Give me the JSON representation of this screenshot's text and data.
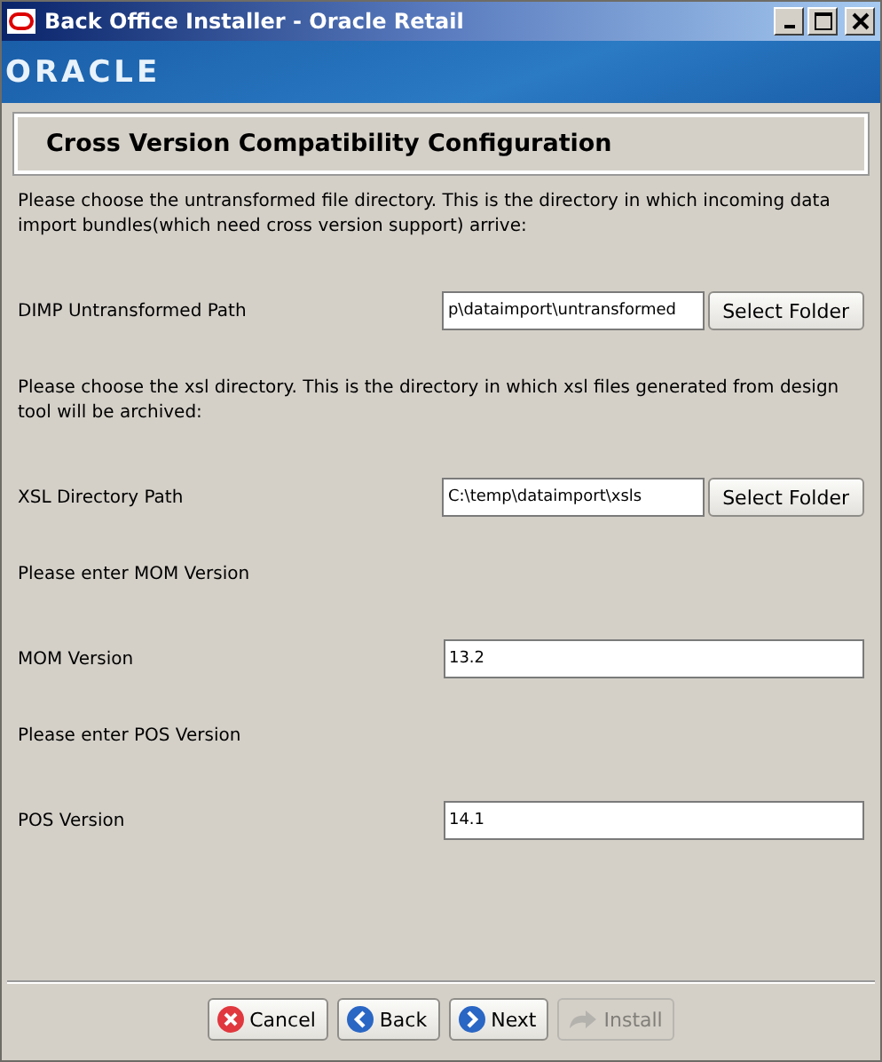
{
  "window": {
    "title": "Back Office Installer - Oracle Retail"
  },
  "banner": {
    "logo": "ORACLE"
  },
  "header": {
    "title": "Cross Version Compatibility Configuration"
  },
  "sections": [
    {
      "prompt": "Please choose the untransformed file directory. This is the directory in which incoming data import bundles(which need cross version support) arrive:",
      "label": "DIMP Untransformed Path",
      "value": "p\\dataimport\\untransformed",
      "button": "Select Folder"
    },
    {
      "prompt": "Please choose the xsl directory. This is the directory in which xsl files generated from design tool will be archived:",
      "label": "XSL Directory Path",
      "value": "C:\\temp\\dataimport\\xsls",
      "button": "Select Folder"
    },
    {
      "prompt": "Please enter MOM Version",
      "label": "MOM Version",
      "value": "13.2"
    },
    {
      "prompt": "Please enter POS Version",
      "label": "POS Version",
      "value": "14.1"
    }
  ],
  "buttons": [
    {
      "kind": "cancel",
      "label": "Cancel",
      "disabled": false
    },
    {
      "kind": "back",
      "label": "Back",
      "disabled": false
    },
    {
      "kind": "next",
      "label": "Next",
      "disabled": false
    },
    {
      "kind": "install",
      "label": "Install",
      "disabled": true
    }
  ]
}
